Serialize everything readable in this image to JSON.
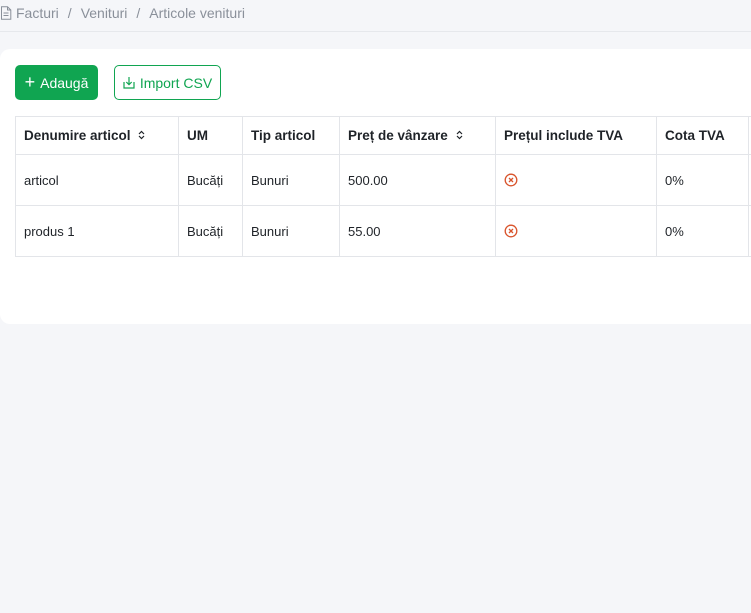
{
  "breadcrumb": {
    "items": [
      "Facturi",
      "Venituri",
      "Articole venituri"
    ],
    "separator": "/"
  },
  "toolbar": {
    "add_label": "Adaugă",
    "import_label": "Import CSV"
  },
  "table": {
    "columns": [
      "Denumire articol",
      "UM",
      "Tip articol",
      "Preț de vânzare",
      "Prețul include TVA",
      "Cota TVA"
    ],
    "rows": [
      {
        "name": "articol",
        "um": "Bucăți",
        "type": "Bunuri",
        "price": "500.00",
        "vat_included_icon": "x-circle-icon",
        "vat_rate": "0%"
      },
      {
        "name": "produs 1",
        "um": "Bucăți",
        "type": "Bunuri",
        "price": "55.00",
        "vat_included_icon": "x-circle-icon",
        "vat_rate": "0%"
      }
    ]
  },
  "colors": {
    "accent": "#10a551",
    "negative_icon": "#d9542c",
    "background": "#f5f6f9"
  }
}
